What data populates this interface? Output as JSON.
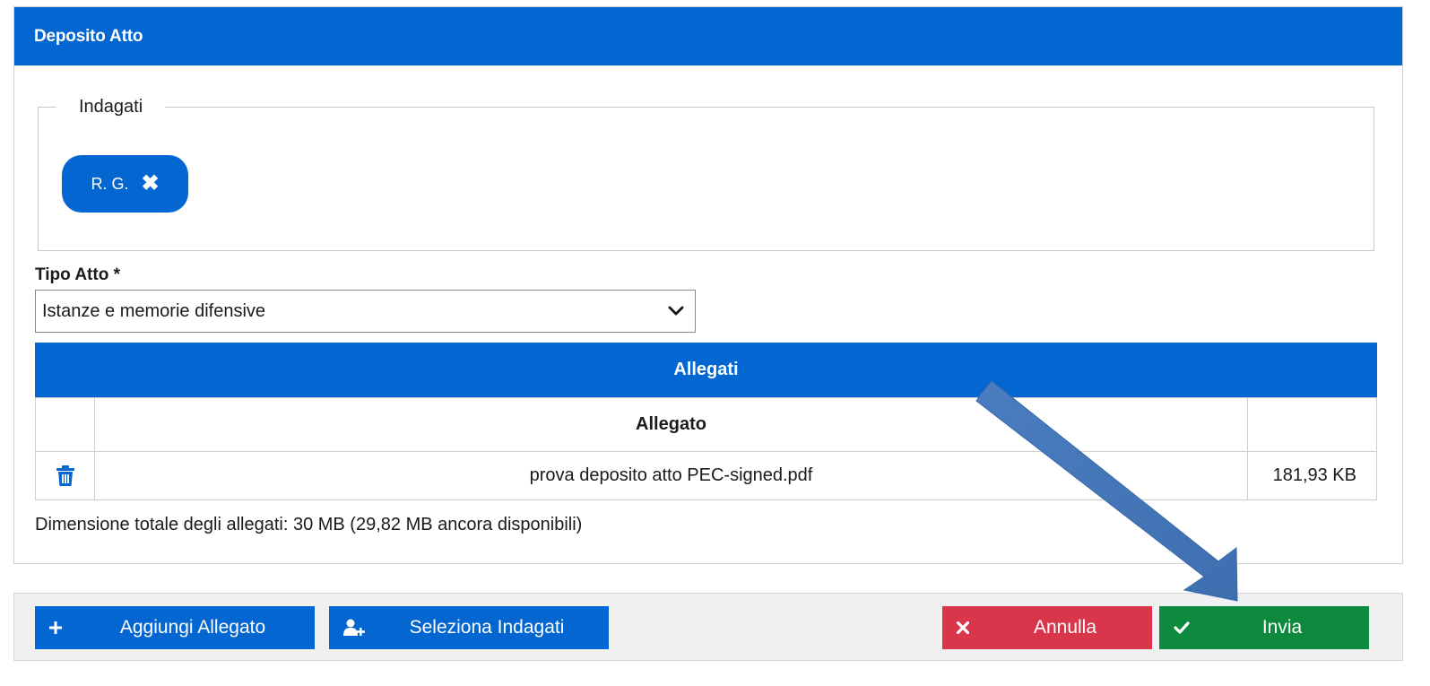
{
  "panel": {
    "title": "Deposito Atto"
  },
  "indagati": {
    "legend": "Indagati",
    "chips": [
      {
        "label": "R. G.",
        "remove_icon": "close-icon"
      }
    ]
  },
  "tipo_atto": {
    "label": "Tipo Atto *",
    "selected": "Istanze e memorie difensive",
    "icon": "chevron-down-icon"
  },
  "allegati": {
    "header": "Allegati",
    "columns": [
      "",
      "Allegato",
      ""
    ],
    "rows": [
      {
        "icon": "trash-icon",
        "name": "prova deposito atto PEC-signed.pdf",
        "size": "181,93 KB"
      }
    ],
    "totale": "Dimensione totale degli allegati: 30 MB (29,82 MB ancora disponibili)"
  },
  "toolbar": {
    "aggiungi_label": "Aggiungi Allegato",
    "seleziona_label": "Seleziona Indagati",
    "annulla_label": "Annulla",
    "invia_label": "Invia"
  },
  "colors": {
    "primary": "#0466d0",
    "danger": "#d9364b",
    "success": "#0d8a3e",
    "annotation_arrow": "#4a7dc0"
  }
}
